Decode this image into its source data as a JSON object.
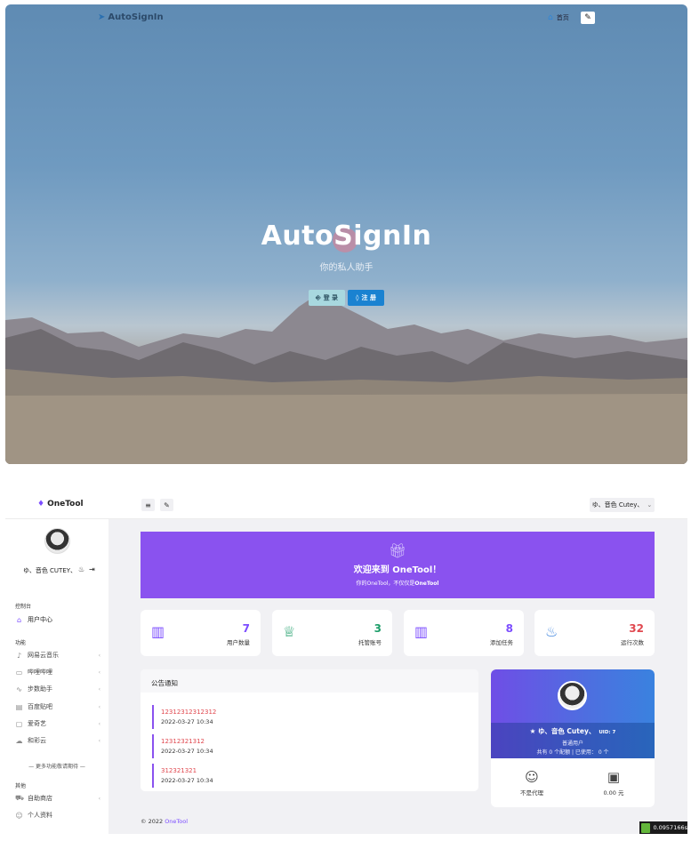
{
  "hero": {
    "brand": "AutoSignIn",
    "nav_home": "首页",
    "title": "AutoSignIn",
    "subtitle": "你的私人助手",
    "login_label": "登 录",
    "register_label": "注 册"
  },
  "app": {
    "logo": "OneTool",
    "user_menu": "ゆ、音色 Cutey、"
  },
  "sidebar": {
    "user_name": "ゆ、音色 CUTEY、",
    "sec_console": "控制台",
    "item_user_center": "用户中心",
    "sec_features": "功能",
    "features": [
      "网易云音乐",
      "哔哩哔哩",
      "步数助手",
      "百度贴吧",
      "爱奇艺",
      "和彩云"
    ],
    "more": "— 更多功能敬请期待 —",
    "sec_other": "其他",
    "other": [
      "自助商店",
      "个人资料"
    ]
  },
  "banner": {
    "title": "欢迎来到 OneTool！",
    "sub_prefix": "你的OneTool，不仅仅是",
    "sub_bold": "OneTool"
  },
  "stats": [
    {
      "value": "7",
      "label": "用户数量",
      "color": "#7c4dff"
    },
    {
      "value": "3",
      "label": "托管账号",
      "color": "#1e9e6a"
    },
    {
      "value": "8",
      "label": "添加任务",
      "color": "#7c4dff"
    },
    {
      "value": "32",
      "label": "运行次数",
      "color": "#e0484f"
    }
  ],
  "notice": {
    "title": "公告通知",
    "items": [
      {
        "title": "12312312312312",
        "date": "2022-03-27 10:34"
      },
      {
        "title": "12312321312",
        "date": "2022-03-27 10:34"
      },
      {
        "title": "312321321",
        "date": "2022-03-27 10:34"
      }
    ]
  },
  "profile": {
    "name": "ゆ、音色 Cutey、",
    "uid": "UID: 7",
    "role": "普通用户",
    "keys": "共有 0 个配额 | 已使用： 0 个",
    "agent": "不是代理",
    "balance": "0.00 元"
  },
  "footer": {
    "prefix": "© 2022",
    "link": "OneTool"
  },
  "badge": "0.0957166s"
}
